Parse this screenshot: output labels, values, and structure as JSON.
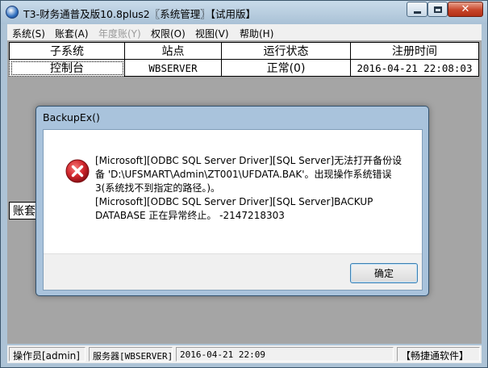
{
  "window": {
    "title": "T3-财务通普及版10.8plus2〖系统管理〗【试用版】"
  },
  "menu": [
    {
      "label": "系统(S)",
      "enabled": true
    },
    {
      "label": "账套(A)",
      "enabled": true
    },
    {
      "label": "年度账(Y)",
      "enabled": false
    },
    {
      "label": "权限(O)",
      "enabled": true
    },
    {
      "label": "视图(V)",
      "enabled": true
    },
    {
      "label": "帮助(H)",
      "enabled": true
    }
  ],
  "grid": {
    "columns": [
      "子系统",
      "站点",
      "运行状态",
      "注册时间"
    ],
    "rows": [
      {
        "subsystem": "控制台",
        "site": "WBSERVER",
        "status": "正常(0)",
        "time": "2016-04-21 22:08:03"
      }
    ]
  },
  "partial_label": "账套",
  "dialog": {
    "title": "BackupEx()",
    "message_lines": [
      "[Microsoft][ODBC SQL Server Driver][SQL Server]无法打开备份设",
      "备 'D:\\UFSMART\\Admin\\ZT001\\UFDATA.BAK'。出现操作系统错误",
      "3(系统找不到指定的路径。)。",
      "[Microsoft][ODBC SQL Server Driver][SQL Server]BACKUP",
      "DATABASE 正在异常终止。 -2147218303"
    ],
    "ok_label": "确定",
    "icon": "error-icon"
  },
  "statusbar": {
    "operator": "操作员[admin]",
    "server": "服务器[WBSERVER]",
    "datetime": "2016-04-21 22:09",
    "brand": "【畅捷通软件】"
  },
  "colors": {
    "error_red": "#d0262c",
    "title_bar": "#b9cfe2",
    "client_gray": "#a5a5a5"
  }
}
